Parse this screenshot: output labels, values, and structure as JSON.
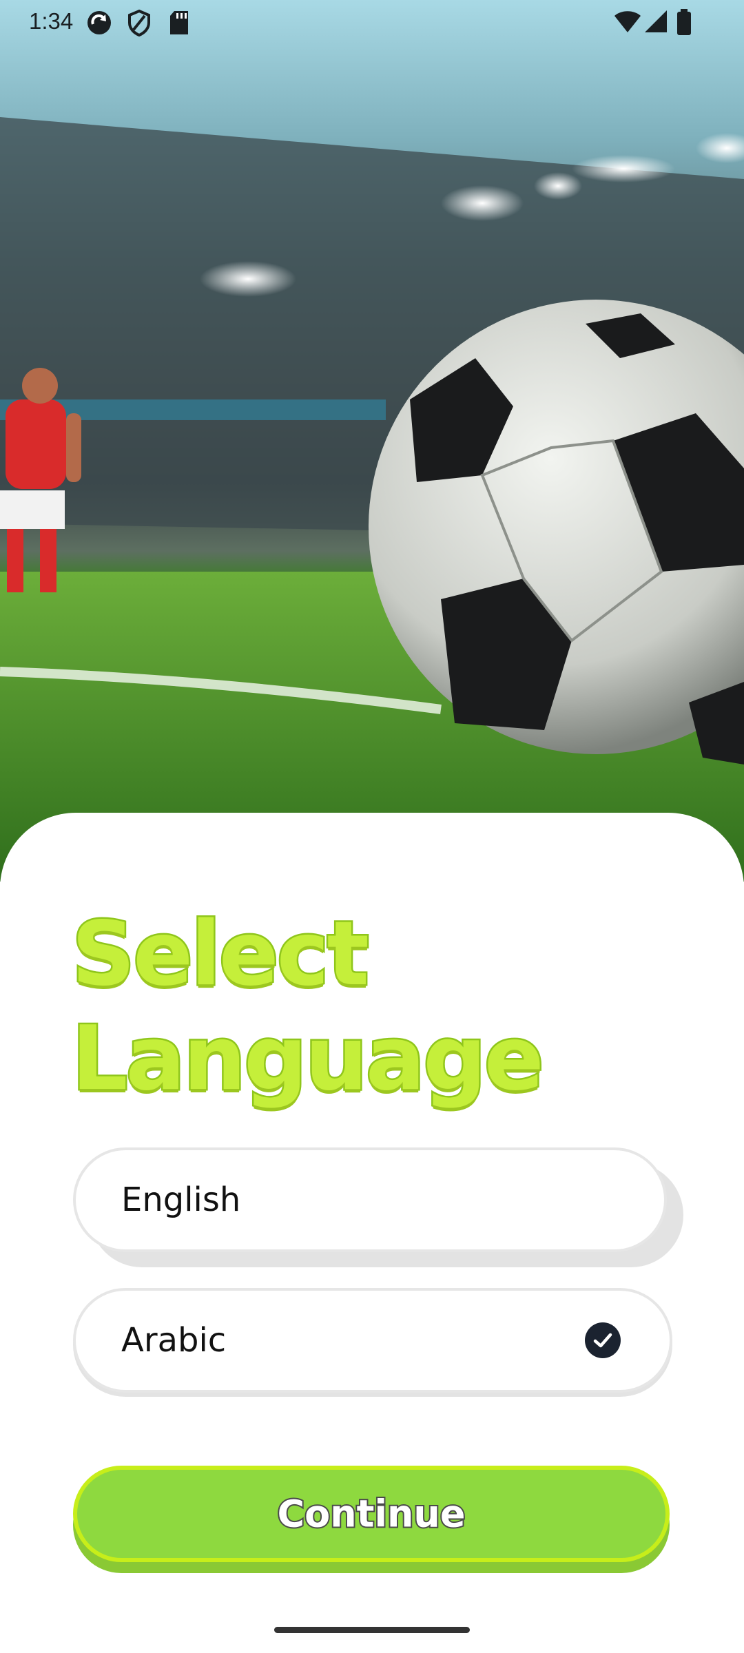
{
  "status_bar": {
    "time": "1:34"
  },
  "hero": {
    "icon": "soccer-ball-stadium-illustration"
  },
  "sheet": {
    "title_line1": "Select",
    "title_line2": "Language",
    "options": [
      {
        "label": "English",
        "selected": false
      },
      {
        "label": "Arabic",
        "selected": true
      }
    ],
    "continue_label": "Continue"
  },
  "colors": {
    "title_green": "#c5ef3a",
    "button_green": "#8ed93f",
    "check_dark": "#1b2330"
  }
}
